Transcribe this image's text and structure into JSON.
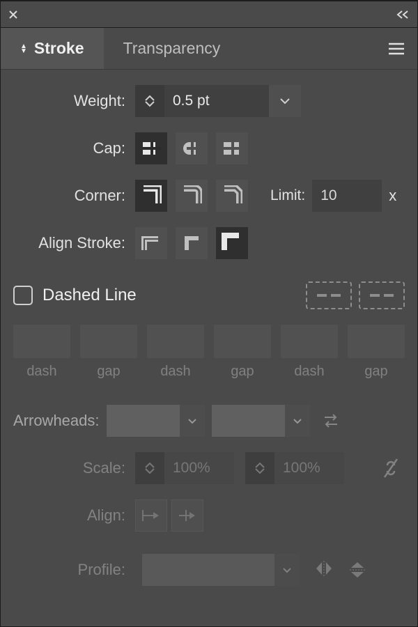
{
  "tabs": {
    "stroke": "Stroke",
    "transparency": "Transparency"
  },
  "labels": {
    "weight": "Weight:",
    "cap": "Cap:",
    "corner": "Corner:",
    "limit": "Limit:",
    "alignStroke": "Align Stroke:",
    "dashedLine": "Dashed Line",
    "arrowheads": "Arrowheads:",
    "scale": "Scale:",
    "align": "Align:",
    "profile": "Profile:"
  },
  "weight": {
    "value": "0.5 pt"
  },
  "cap": {
    "options": [
      "butt",
      "round",
      "projecting"
    ],
    "selected": "butt"
  },
  "corner": {
    "options": [
      "miter",
      "round",
      "bevel"
    ],
    "selected": "miter",
    "limit": "10",
    "suffix": "x"
  },
  "alignStroke": {
    "options": [
      "center",
      "inside",
      "outside"
    ],
    "selected": "outside"
  },
  "dashedLine": {
    "checked": false,
    "columns": [
      "dash",
      "gap",
      "dash",
      "gap",
      "dash",
      "gap"
    ]
  },
  "arrowheads": {
    "start": "",
    "end": ""
  },
  "scale": {
    "start": "100%",
    "end": "100%"
  },
  "alignArrow": {
    "options": [
      "extend",
      "place"
    ]
  },
  "profile": {
    "value": ""
  },
  "icons": {
    "close": "close-icon",
    "collapse": "collapse-icon",
    "menu": "panel-menu-icon",
    "chevronDown": "chevron-down-icon",
    "swap": "swap-arrows-icon",
    "link": "link-icon",
    "flipH": "flip-horizontal-icon",
    "flipV": "flip-vertical-icon"
  }
}
